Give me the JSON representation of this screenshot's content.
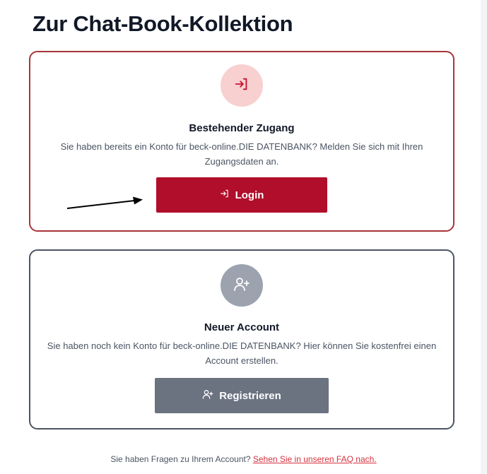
{
  "page": {
    "title": "Zur Chat-Book-Kollektion"
  },
  "login_card": {
    "icon": "login-icon",
    "heading": "Bestehender Zugang",
    "text": "Sie haben bereits ein Konto für beck-online.DIE DATENBANK? Melden Sie sich mit Ihren Zugangsdaten an.",
    "button_label": "Login",
    "accent_color": "#b00e2a"
  },
  "register_card": {
    "icon": "user-plus-icon",
    "heading": "Neuer Account",
    "text": "Sie haben noch kein Konto für beck-online.DIE DATENBANK? Hier können Sie kostenfrei einen Account erstellen.",
    "button_label": "Registrieren",
    "accent_color": "#6b7280"
  },
  "footer": {
    "question": "Sie haben Fragen zu Ihrem Account?",
    "link_text": "Sehen Sie in unseren FAQ nach."
  }
}
